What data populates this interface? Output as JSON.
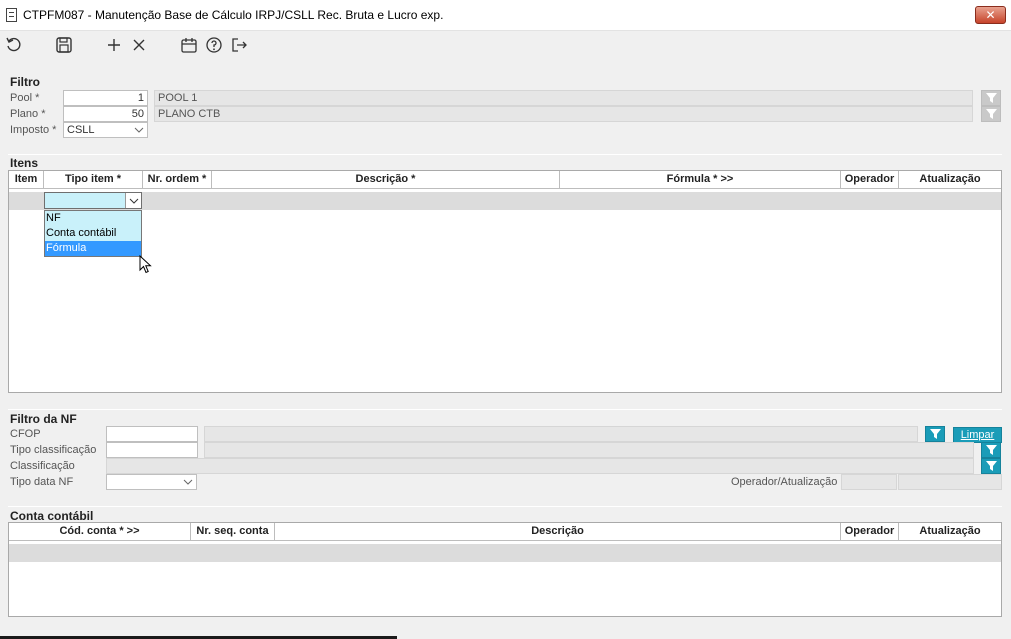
{
  "window": {
    "title": "CTPFM087 - Manutenção Base de Cálculo IRPJ/CSLL Rec. Bruta e Lucro exp.",
    "close_label": "✕"
  },
  "toolbar": {
    "icons": [
      "undo-icon",
      "save-icon",
      "add-icon",
      "delete-icon",
      "calendar-icon",
      "help-icon",
      "exit-icon"
    ]
  },
  "filtro": {
    "title": "Filtro",
    "pool_label": "Pool *",
    "pool_value": "1",
    "pool_desc": "POOL 1",
    "plano_label": "Plano *",
    "plano_value": "50",
    "plano_desc": "PLANO CTB",
    "imposto_label": "Imposto *",
    "imposto_value": "CSLL"
  },
  "itens": {
    "title": "Itens",
    "columns": [
      "Item",
      "Tipo item *",
      "Nr. ordem *",
      "Descrição *",
      "Fórmula * >>",
      "Operador",
      "Atualização"
    ],
    "tipo_options": [
      "NF",
      "Conta contábil",
      "Fórmula"
    ],
    "tipo_highlighted": "Fórmula"
  },
  "filtro_nf": {
    "title": "Filtro da NF",
    "cfop_label": "CFOP",
    "tipo_class_label": "Tipo classificação",
    "classificacao_label": "Classificação",
    "tipo_data_label": "Tipo data NF",
    "operador_label": "Operador/Atualização",
    "limpar_label": "Limpar"
  },
  "conta": {
    "title": "Conta contábil",
    "columns": [
      "Cód. conta * >>",
      "Nr. seq. conta",
      "Descrição",
      "Operador",
      "Atualização"
    ]
  },
  "colors": {
    "accent": "#1a9cb8",
    "dropdown_bg": "#c9f1fa",
    "selection": "#3399ff"
  }
}
